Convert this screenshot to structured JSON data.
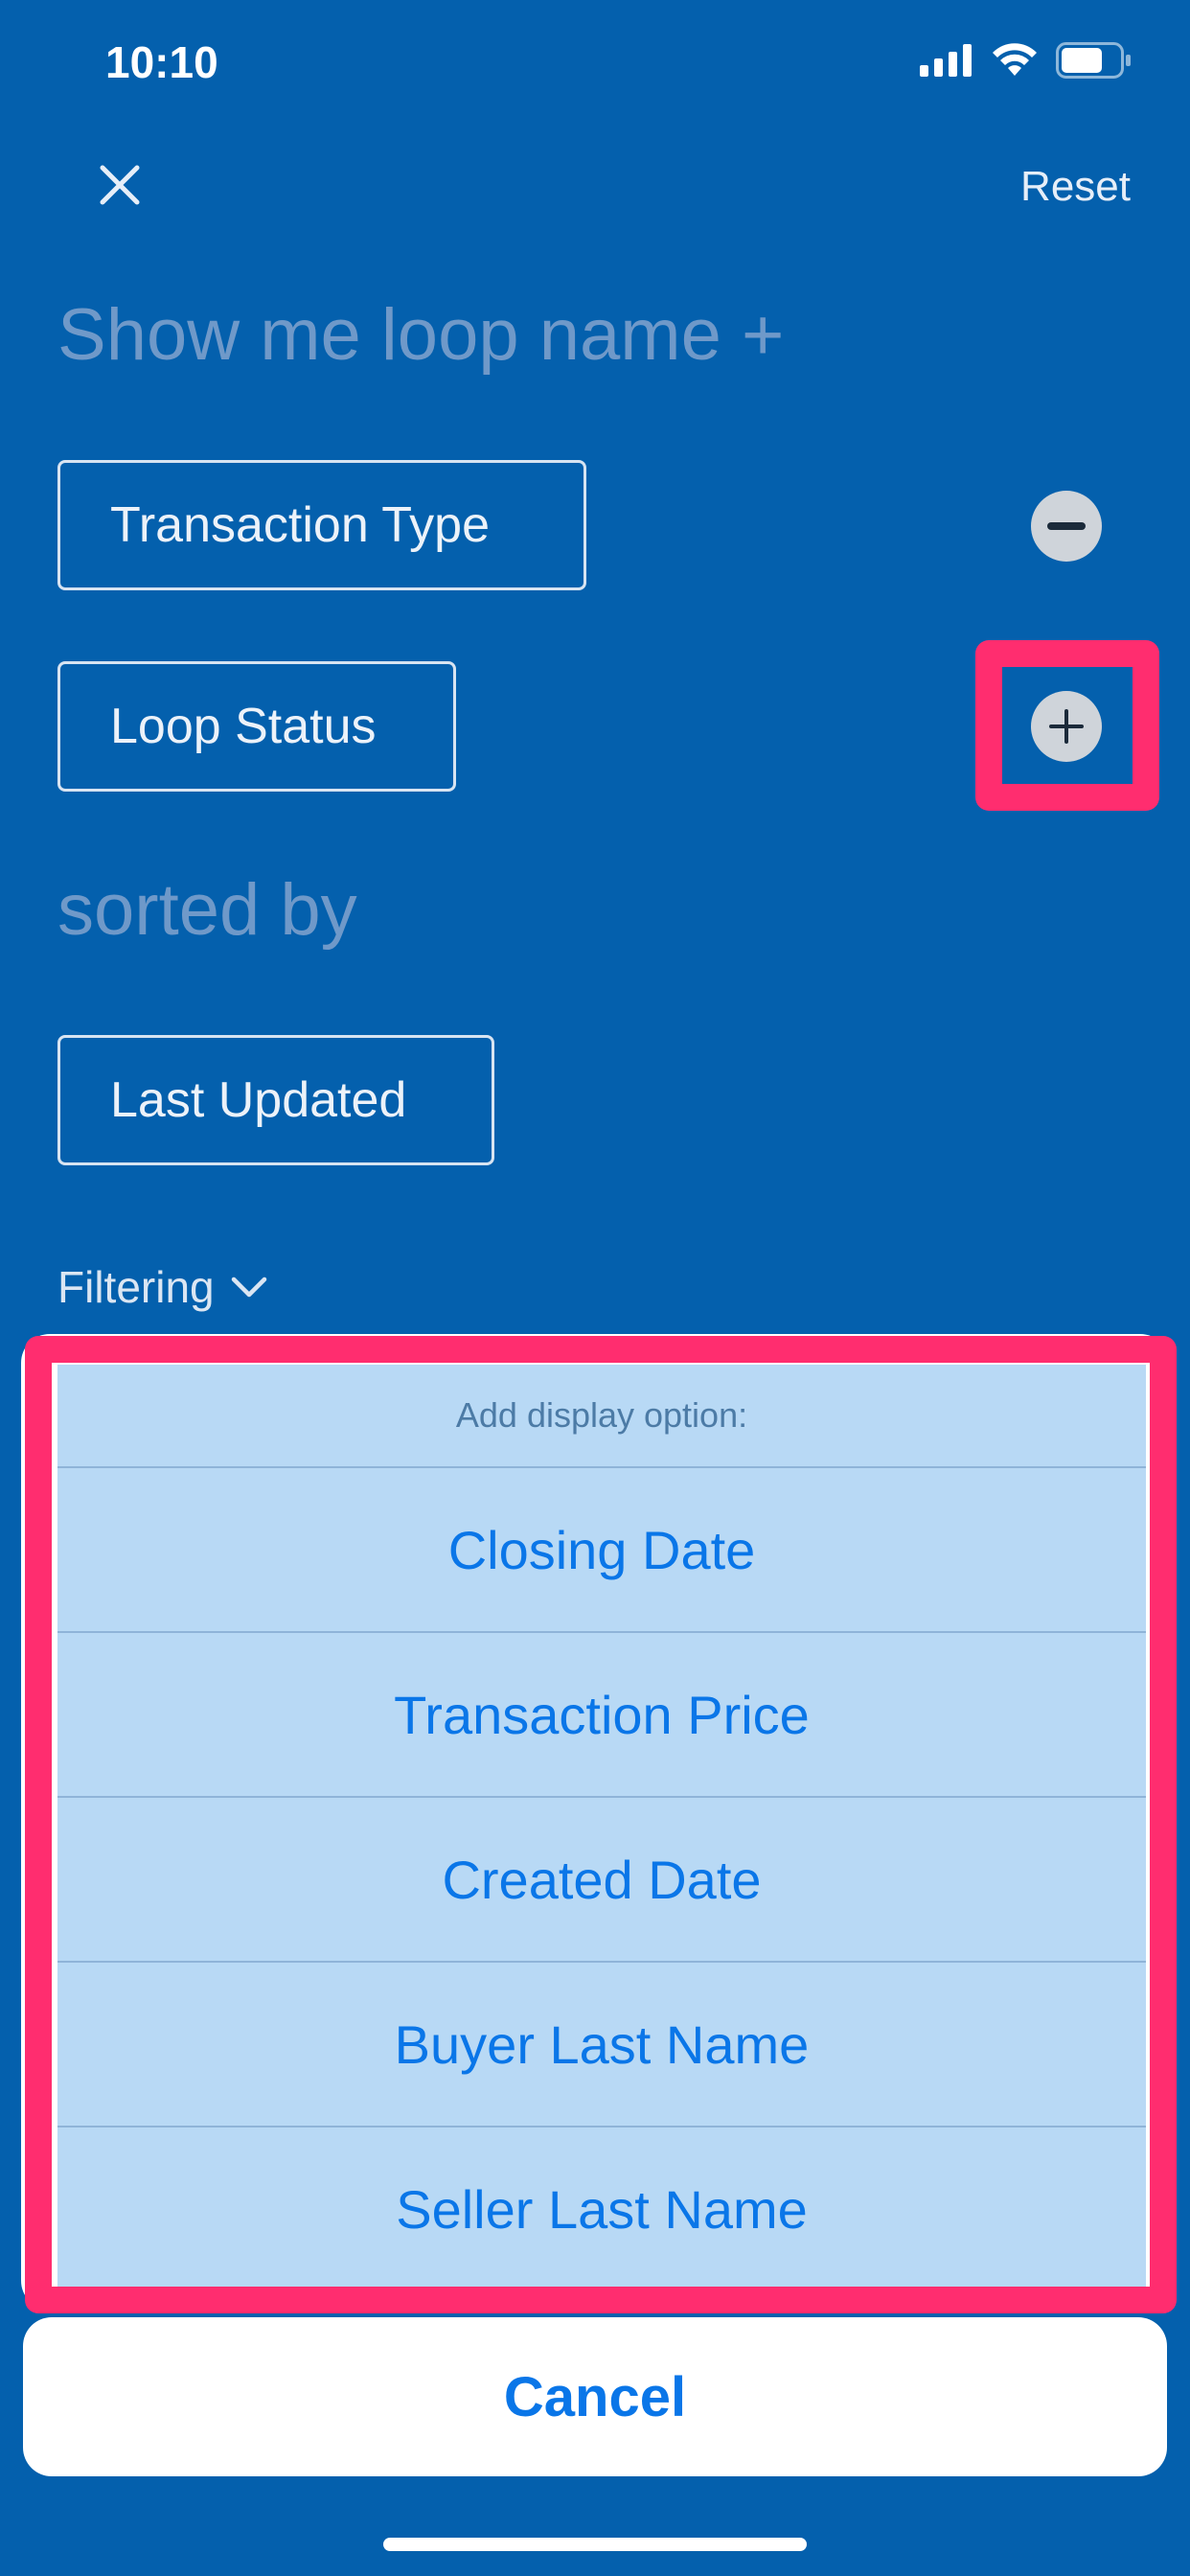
{
  "status_bar": {
    "time": "10:10"
  },
  "header": {
    "reset_label": "Reset"
  },
  "main": {
    "heading": "Show me loop name +",
    "fields": [
      {
        "label": "Transaction Type",
        "action": "remove"
      },
      {
        "label": "Loop Status",
        "action": "add"
      }
    ],
    "sort_heading": "sorted by",
    "sort_field": "Last Updated",
    "filtering_label": "Filtering"
  },
  "action_sheet": {
    "title": "Add display option:",
    "options": [
      "Closing Date",
      "Transaction Price",
      "Created Date",
      "Buyer Last Name",
      "Seller Last Name"
    ],
    "cancel_label": "Cancel"
  },
  "colors": {
    "background": "#0460ad",
    "highlight": "#ff2d6f",
    "option_text": "#0a76e8"
  }
}
